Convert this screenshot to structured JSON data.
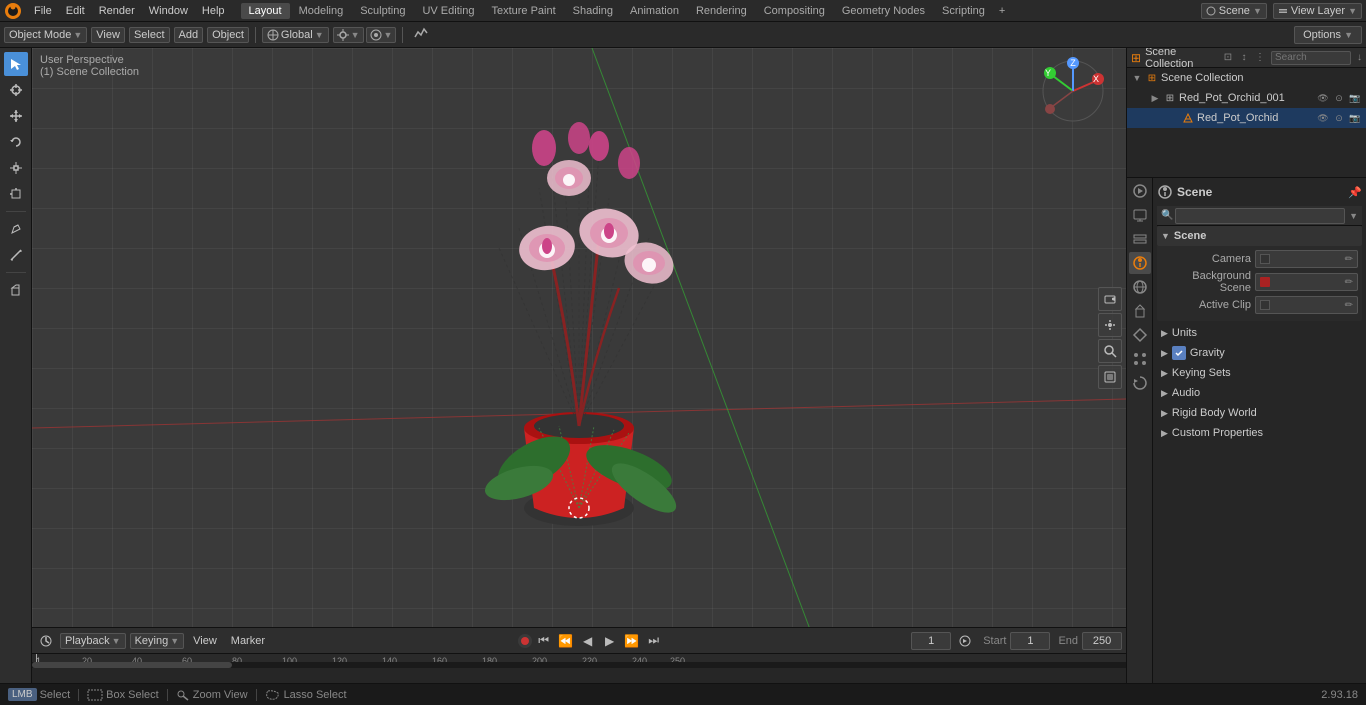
{
  "app": {
    "version": "2.93.18"
  },
  "top_menu": {
    "file": "File",
    "edit": "Edit",
    "render": "Render",
    "window": "Window",
    "help": "Help"
  },
  "layout_tabs": [
    {
      "label": "Layout",
      "active": true
    },
    {
      "label": "Modeling",
      "active": false
    },
    {
      "label": "Sculpting",
      "active": false
    },
    {
      "label": "UV Editing",
      "active": false
    },
    {
      "label": "Texture Paint",
      "active": false
    },
    {
      "label": "Shading",
      "active": false
    },
    {
      "label": "Animation",
      "active": false
    },
    {
      "label": "Rendering",
      "active": false
    },
    {
      "label": "Compositing",
      "active": false
    },
    {
      "label": "Geometry Nodes",
      "active": false
    },
    {
      "label": "Scripting",
      "active": false
    }
  ],
  "header": {
    "scene_label": "Scene",
    "view_layer_label": "View Layer"
  },
  "viewport_toolbar": {
    "object_mode": "Object Mode",
    "view": "View",
    "select": "Select",
    "add": "Add",
    "object": "Object",
    "transform": "Global",
    "options_label": "Options"
  },
  "viewport": {
    "perspective": "User Perspective",
    "scene_collection": "(1) Scene Collection"
  },
  "outliner": {
    "title": "Scene Collection",
    "search_placeholder": "Search",
    "items": [
      {
        "name": "Red_Pot_Orchid_001",
        "type": "collection",
        "expanded": true,
        "level": 1
      },
      {
        "name": "Red_Pot_Orchid",
        "type": "mesh",
        "expanded": false,
        "level": 2
      }
    ]
  },
  "properties": {
    "header_title": "Scene",
    "scene_section": {
      "title": "Scene",
      "camera_label": "Camera",
      "camera_value": "",
      "background_scene_label": "Background Scene",
      "active_clip_label": "Active Clip"
    },
    "units_label": "Units",
    "gravity_label": "Gravity",
    "gravity_checked": true,
    "keying_sets_label": "Keying Sets",
    "audio_label": "Audio",
    "rigid_body_world_label": "Rigid Body World",
    "custom_properties_label": "Custom Properties"
  },
  "timeline": {
    "playback_label": "Playback",
    "keying_label": "Keying",
    "view_label": "View",
    "marker_label": "Marker",
    "current_frame": "1",
    "start_label": "Start",
    "start_value": "1",
    "end_label": "End",
    "end_value": "250",
    "frame_marks": [
      "1",
      "20",
      "40",
      "60",
      "80",
      "100",
      "120",
      "140",
      "160",
      "180",
      "200",
      "220",
      "240",
      "250"
    ]
  },
  "status_bar": {
    "select_label": "Select",
    "box_select_label": "Box Select",
    "zoom_view_label": "Zoom View",
    "lasso_select_label": "Lasso Select",
    "version": "2.93.18"
  }
}
